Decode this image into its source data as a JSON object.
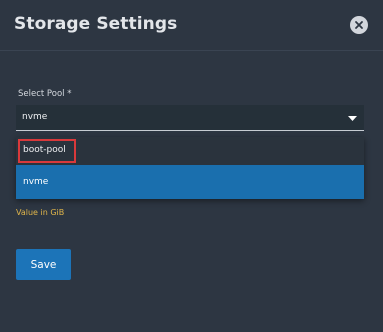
{
  "dialog": {
    "title": "Storage Settings",
    "close_icon": "close-icon"
  },
  "form": {
    "pool_label": "Select Pool *",
    "pool_value": "nvme",
    "hint": "Value in GiB",
    "save_label": "Save"
  },
  "dropdown": {
    "options": [
      {
        "label": "boot-pool",
        "highlighted_box": true
      },
      {
        "label": "nvme",
        "selected": true
      }
    ]
  },
  "colors": {
    "background": "#2d3642",
    "accent": "#1c74b8",
    "selected_option": "#1a6fae",
    "hint": "#e0b54a",
    "highlight_box": "#d9393b"
  }
}
